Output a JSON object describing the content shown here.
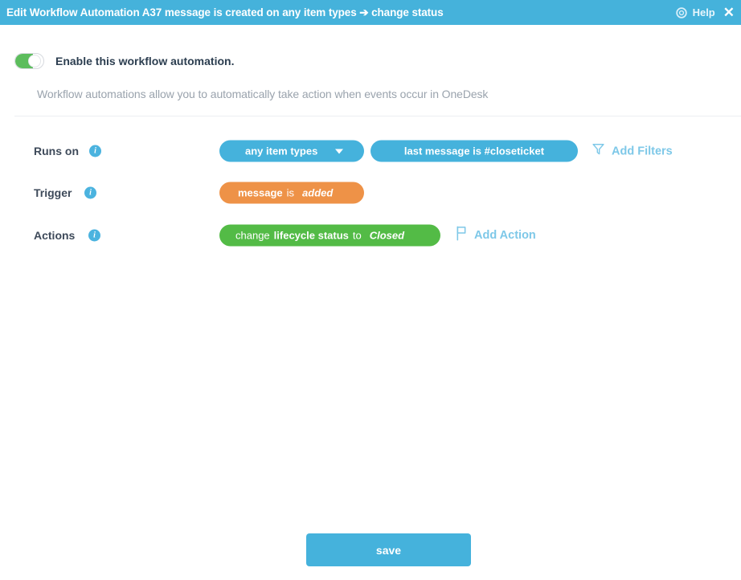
{
  "titlebar": {
    "title": "Edit Workflow Automation A37 message is created on any item types ➔ change status",
    "help_label": "Help",
    "help_icon": "lifebuoy-icon",
    "close_icon": "close-icon",
    "close_glyph": "✕",
    "background_color": "#45b2db"
  },
  "enable": {
    "label": "Enable this workflow automation.",
    "state": "on",
    "toggle_on_color": "#5cbd5c"
  },
  "description": "Workflow automations allow you to automatically take action when events occur in OneDesk",
  "rows": {
    "runs_on": {
      "label": "Runs on",
      "info_icon": "info-icon",
      "info_glyph": "i",
      "item_types_pill": {
        "text": "any item types",
        "color": "#45b2dc",
        "caret_icon": "chevron-down-icon"
      },
      "filter_pill": {
        "text": "last message is #closeticket",
        "color": "#45b2dc"
      },
      "add_filters": {
        "label": "Add Filters",
        "icon": "funnel-icon",
        "color": "#7ec8e8"
      }
    },
    "trigger": {
      "label": "Trigger",
      "info_icon": "info-icon",
      "info_glyph": "i",
      "pill": {
        "subject": "message",
        "connector": "is",
        "value": "added",
        "color": "#ee9247"
      }
    },
    "actions": {
      "label": "Actions",
      "info_icon": "info-icon",
      "info_glyph": "i",
      "pill": {
        "verb": "change",
        "field": "lifecycle status",
        "connector": "to",
        "value": "Closed",
        "color": "#53bb46"
      },
      "add_action": {
        "label": "Add Action",
        "icon": "flag-icon",
        "color": "#7ec8e8"
      }
    }
  },
  "footer": {
    "save_label": "save",
    "save_color": "#45b2dc"
  }
}
